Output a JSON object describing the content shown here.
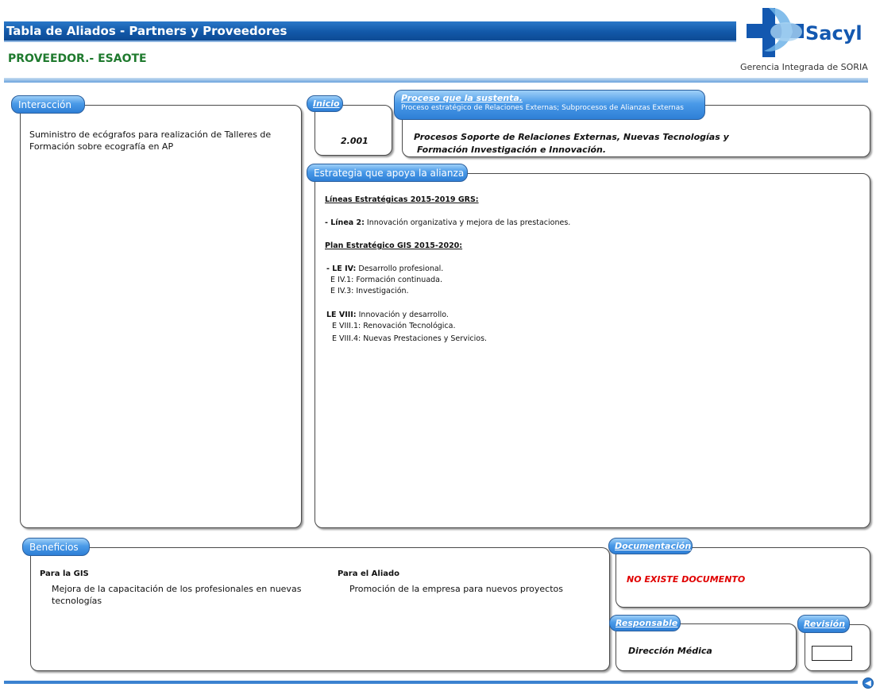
{
  "header": {
    "title": "Tabla de Aliados - Partners y Proveedores",
    "subtitle": "PROVEEDOR.- ESAOTE"
  },
  "logo": {
    "brand": "Sacyl",
    "org": "Gerencia Integrada de SORIA"
  },
  "interaccion": {
    "tab": "Interacción",
    "text": "Suministro de ecógrafos para realización de Talleres de Formación sobre ecografía en AP"
  },
  "inicio": {
    "tab": "Inicio",
    "value": "2.001"
  },
  "proceso": {
    "tab": "Proceso que la sustenta.",
    "tab_sub": "Proceso estratégico de Relaciones Externas; Subprocesos de Alianzas Externas",
    "line1": "Procesos Soporte de Relaciones Externas, Nuevas Tecnologías y",
    "line2": "Formación Investigación e Innovación."
  },
  "estrategia": {
    "tab": "Estrategia que apoya la alianza",
    "h1": "Líneas Estratégicas 2015-2019  GRS:",
    "l2_bold": "- Línea 2:",
    "l2_text": " Innovación organizativa y mejora de las prestaciones.",
    "h2": "Plan Estratégico GIS 2015-2020:",
    "le4_bold": "- LE IV:",
    "le4_text": " Desarrollo profesional.",
    "e41": "E IV.1: Formación continuada.",
    "e43": "E IV.3: Investigación.",
    "le8_bold": "LE VIII:",
    "le8_text": " Innovación y desarrollo.",
    "e81": "E VIII.1: Renovación Tecnológica.",
    "e84": "E VIII.4: Nuevas Prestaciones y Servicios."
  },
  "beneficios": {
    "tab": "Beneficios",
    "gis_label": "Para la GIS",
    "gis_text": "Mejora de la capacitación de los profesionales en nuevas tecnologías",
    "aliado_label": "Para el Aliado",
    "aliado_text": "Promoción de la empresa para nuevos proyectos"
  },
  "documentacion": {
    "tab": "Documentación",
    "value": "NO EXISTE DOCUMENTO",
    "value_color": "#e00000"
  },
  "responsable": {
    "tab": "Responsable",
    "value": "Dirección Médica"
  },
  "revision": {
    "tab": "Revisión",
    "value": ""
  },
  "colors": {
    "title_bar": "#1258a8",
    "tab": "#4a9ae8",
    "subtitle": "#1f7a2e"
  }
}
